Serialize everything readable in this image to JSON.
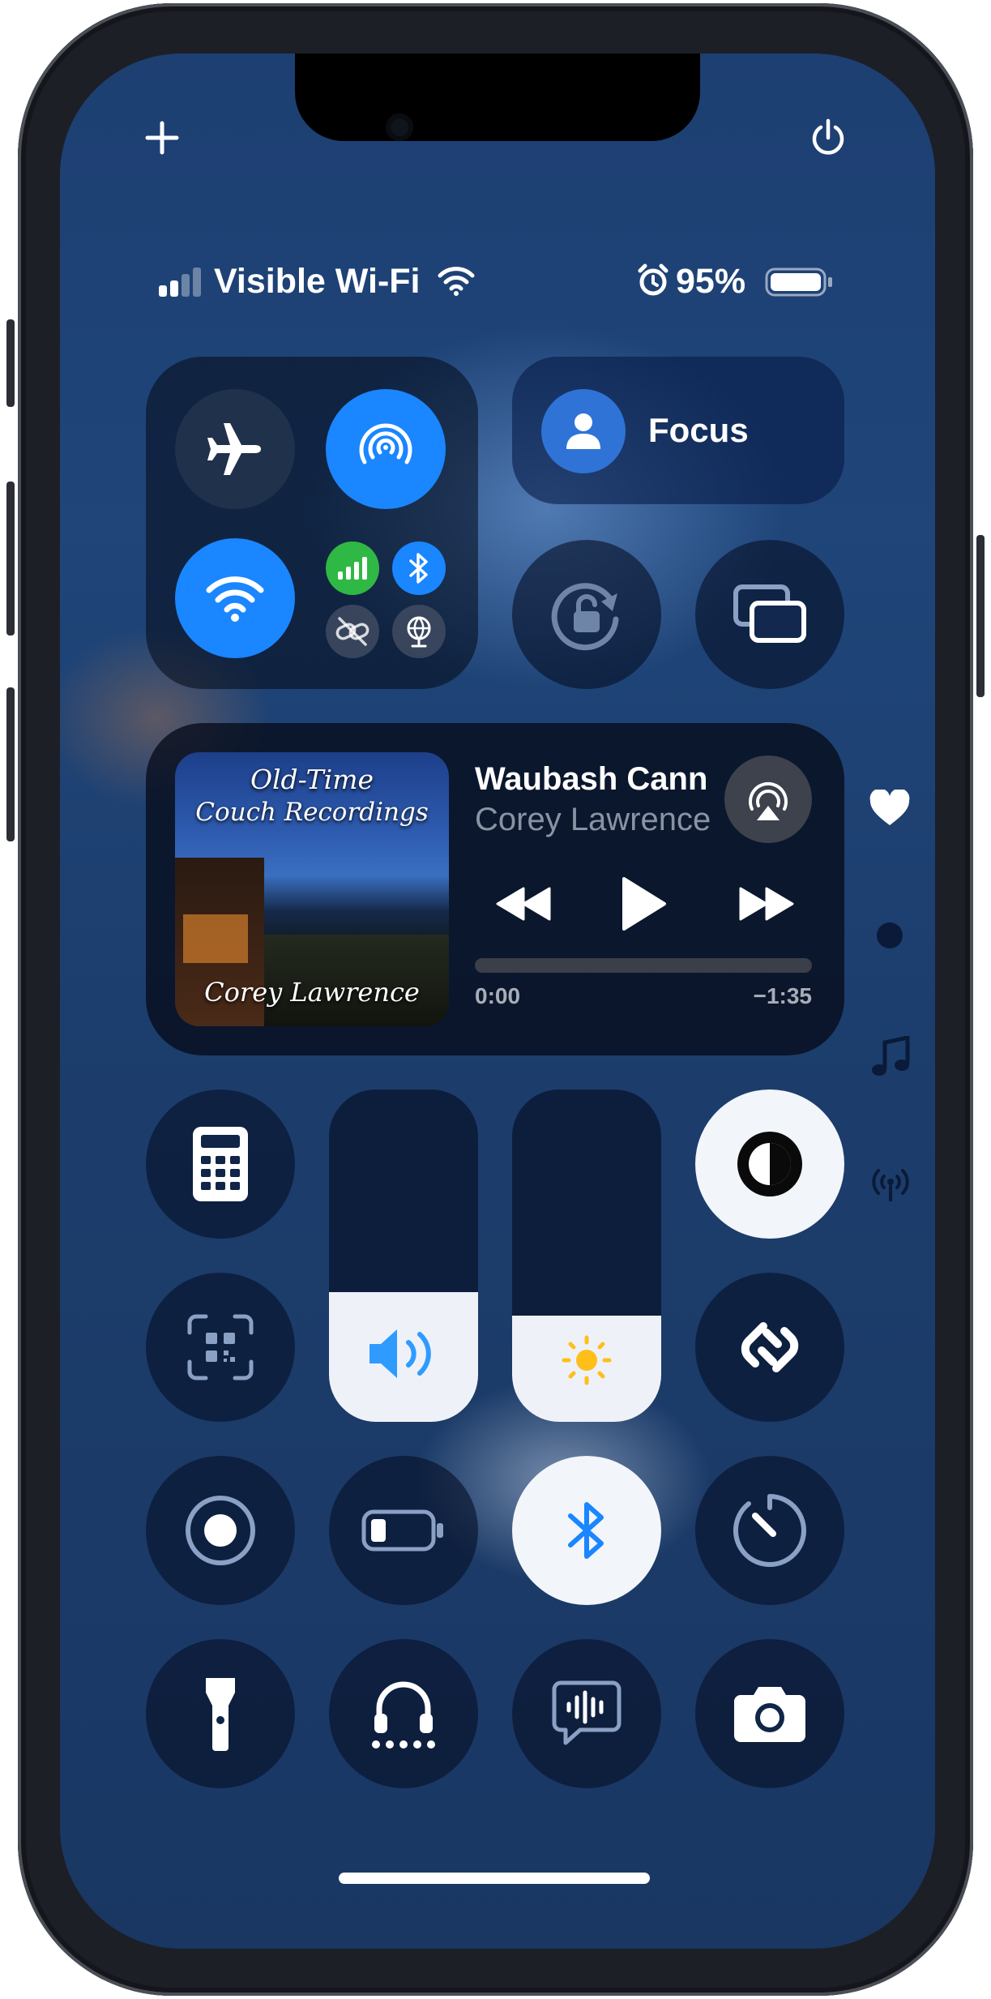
{
  "status_bar": {
    "carrier": "Visible Wi-Fi",
    "battery_percent": "95%",
    "signal_bars_filled": 2,
    "signal_bars_total": 4,
    "battery_level": 0.95
  },
  "top_controls": {
    "add_icon": "plus-icon",
    "power_icon": "power-icon"
  },
  "connectivity": {
    "airplane_mode": "off",
    "airdrop": "on",
    "wifi": "on",
    "cellular": "on",
    "bluetooth": "on",
    "vpn": "off",
    "satellite": "off"
  },
  "focus": {
    "label": "Focus"
  },
  "now_playing": {
    "album_title_line1": "Old-Time",
    "album_title_line2": "Couch Recordings",
    "album_artist": "Corey Lawrence",
    "track_title": "Waubash Cann",
    "artist": "Corey Lawrence",
    "elapsed": "0:00",
    "remaining": "−1:35",
    "progress": 0.0
  },
  "sliders": {
    "volume_level": 0.39,
    "brightness_level": 0.32
  },
  "tiles": [
    "calculator-icon",
    "qr-code-scanner-icon",
    "dark-mode-icon",
    "shazam-icon",
    "screen-recording-icon",
    "low-power-mode-icon",
    "bluetooth-icon",
    "timer-icon",
    "flashlight-icon",
    "hearing-icon",
    "live-speech-icon",
    "camera-icon"
  ],
  "page_indicators": [
    "favorites-heart-icon",
    "page-dot-icon",
    "music-note-icon",
    "connectivity-antenna-icon"
  ],
  "colors": {
    "accent_blue": "#1a86ff",
    "cellular_green": "#2fb844",
    "background": "#1d3f72",
    "active_tile": "#f2f5fa"
  }
}
